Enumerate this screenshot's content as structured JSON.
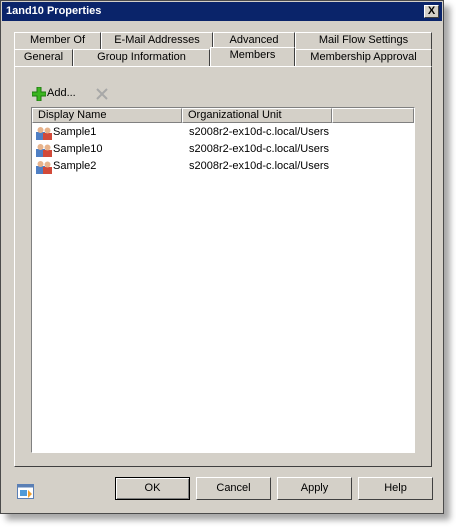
{
  "window": {
    "title": "1and10 Properties",
    "close_label": "X"
  },
  "tabs_row1": [
    "Member Of",
    "E-Mail Addresses",
    "Advanced",
    "Mail Flow Settings"
  ],
  "tabs_row2": [
    "General",
    "Group Information",
    "Members",
    "Membership Approval"
  ],
  "active_tab": "Members",
  "toolbar": {
    "add_label": "Add..."
  },
  "members": {
    "columns": [
      "Display Name",
      "Organizational Unit"
    ],
    "rows": [
      {
        "name": "Sample1",
        "ou": "s2008r2-ex10d-c.local/Users"
      },
      {
        "name": "Sample10",
        "ou": "s2008r2-ex10d-c.local/Users"
      },
      {
        "name": "Sample2",
        "ou": "s2008r2-ex10d-c.local/Users"
      }
    ]
  },
  "buttons": {
    "ok": "OK",
    "cancel": "Cancel",
    "apply": "Apply",
    "help": "Help"
  }
}
